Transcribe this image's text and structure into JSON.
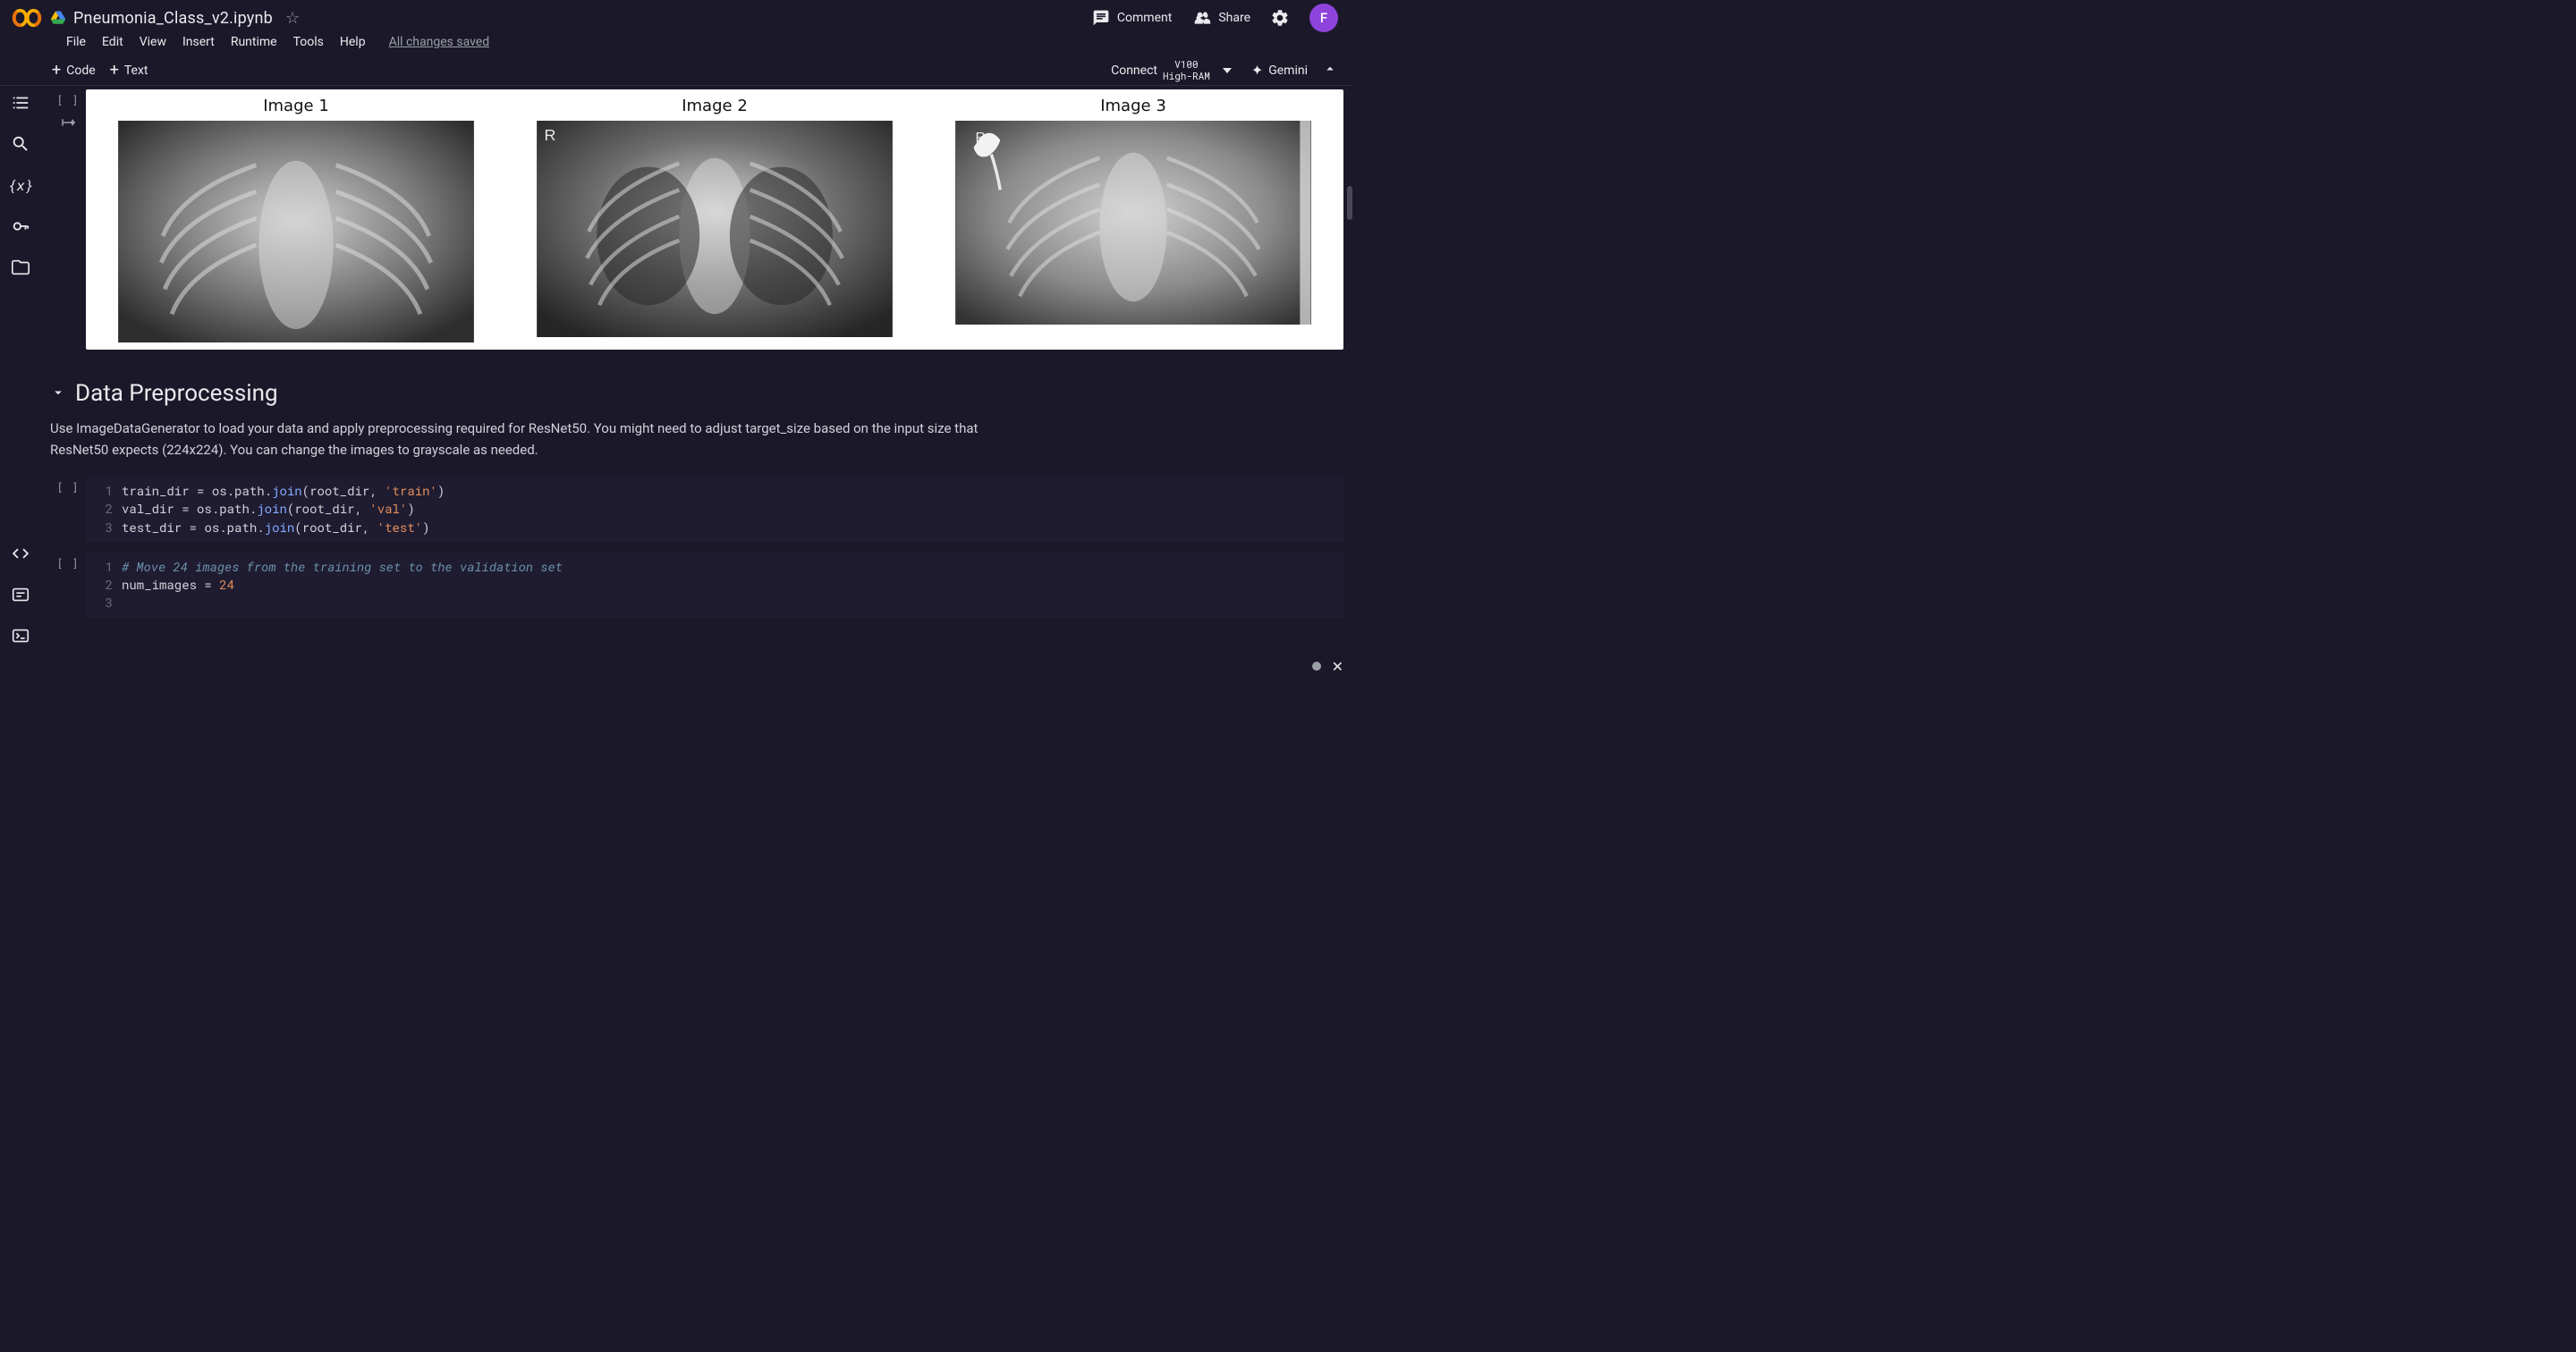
{
  "header": {
    "notebook_title": "Pneumonia_Class_v2.ipynb",
    "comment_label": "Comment",
    "share_label": "Share",
    "avatar_initial": "F"
  },
  "menubar": {
    "items": [
      "File",
      "Edit",
      "View",
      "Insert",
      "Runtime",
      "Tools",
      "Help"
    ],
    "status": "All changes saved"
  },
  "toolbar": {
    "code_label": "Code",
    "text_label": "Text",
    "connect_label": "Connect",
    "runtime_type_line1": "V100",
    "runtime_type_line2": "High-RAM",
    "gemini_label": "Gemini"
  },
  "output_images": {
    "captions": [
      "Image 1",
      "Image 2",
      "Image 3"
    ]
  },
  "section": {
    "heading": "Data Preprocessing",
    "body": "Use ImageDataGenerator to load your data and apply preprocessing required for ResNet50. You might need to adjust target_size based on the input size that ResNet50 expects (224x224). You can change the images to grayscale as needed."
  },
  "code_cell_1": {
    "lines": [
      {
        "n": "1",
        "tokens": [
          [
            "var",
            "train_dir "
          ],
          [
            "op",
            "= "
          ],
          [
            "obj",
            "os"
          ],
          [
            "punct",
            "."
          ],
          [
            "obj",
            "path"
          ],
          [
            "punct",
            "."
          ],
          [
            "method",
            "join"
          ],
          [
            "punct",
            "("
          ],
          [
            "var",
            "root_dir"
          ],
          [
            "punct",
            ", "
          ],
          [
            "str",
            "'train'"
          ],
          [
            "punct",
            ")"
          ]
        ]
      },
      {
        "n": "2",
        "tokens": [
          [
            "var",
            "val_dir "
          ],
          [
            "op",
            "= "
          ],
          [
            "obj",
            "os"
          ],
          [
            "punct",
            "."
          ],
          [
            "obj",
            "path"
          ],
          [
            "punct",
            "."
          ],
          [
            "method",
            "join"
          ],
          [
            "punct",
            "("
          ],
          [
            "var",
            "root_dir"
          ],
          [
            "punct",
            ", "
          ],
          [
            "str",
            "'val'"
          ],
          [
            "punct",
            ")"
          ]
        ]
      },
      {
        "n": "3",
        "tokens": [
          [
            "var",
            "test_dir "
          ],
          [
            "op",
            "= "
          ],
          [
            "obj",
            "os"
          ],
          [
            "punct",
            "."
          ],
          [
            "obj",
            "path"
          ],
          [
            "punct",
            "."
          ],
          [
            "method",
            "join"
          ],
          [
            "punct",
            "("
          ],
          [
            "var",
            "root_dir"
          ],
          [
            "punct",
            ", "
          ],
          [
            "str",
            "'test'"
          ],
          [
            "punct",
            ")"
          ]
        ]
      }
    ]
  },
  "code_cell_2": {
    "lines": [
      {
        "n": "1",
        "tokens": [
          [
            "comment",
            "# Move 24 images from the training set to the validation set"
          ]
        ]
      },
      {
        "n": "2",
        "tokens": [
          [
            "var",
            "num_images "
          ],
          [
            "op",
            "= "
          ],
          [
            "num",
            "24"
          ]
        ]
      },
      {
        "n": "3",
        "tokens": [
          [
            "var",
            ""
          ]
        ]
      }
    ]
  },
  "exec_label": "[ ]"
}
